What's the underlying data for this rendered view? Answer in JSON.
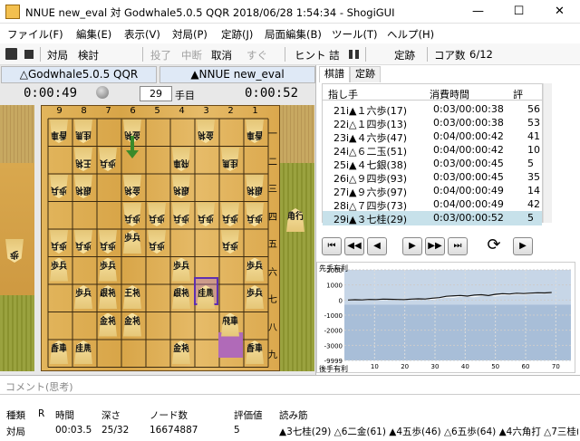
{
  "window": {
    "title": "NNUE new_eval 対 Godwhale5.0.5 QQR 2018/06/28 1:54:34 - ShogiGUI",
    "minimize": "—",
    "maximize": "☐",
    "close": "✕"
  },
  "menu": [
    "ファイル(F)",
    "編集(E)",
    "表示(V)",
    "対局(P)",
    "定跡(J)",
    "局面編集(B)",
    "ツール(T)",
    "ヘルプ(H)"
  ],
  "toolbar": {
    "save_icon": "save-icon",
    "stop_icon": "stop-icon",
    "taikyoku": "対局",
    "kento": "検討",
    "touryo": "投了",
    "chudan": "中断",
    "torikeshi": "取消",
    "sugu": "すぐ",
    "hint": "ヒント",
    "tsume": "詰",
    "jouseki": "定跡",
    "core_label": "コア数",
    "core_value": "6/12"
  },
  "players": {
    "gote": "△Godwhale5.0.5 QQR",
    "sente": "▲NNUE new_eval"
  },
  "clock": {
    "gote": "0:00:49",
    "sente": "0:00:52",
    "move_number": "29",
    "move_suffix": "手目"
  },
  "board": {
    "files": [
      "9",
      "8",
      "7",
      "6",
      "5",
      "4",
      "3",
      "2",
      "1"
    ],
    "ranks": [
      "一",
      "二",
      "三",
      "四",
      "五",
      "六",
      "七",
      "八",
      "九"
    ],
    "pieces": [
      {
        "f": 9,
        "r": 1,
        "p": "香車",
        "side": "gote"
      },
      {
        "f": 8,
        "r": 1,
        "p": "桂馬",
        "side": "gote"
      },
      {
        "f": 6,
        "r": 1,
        "p": "金将",
        "side": "gote"
      },
      {
        "f": 3,
        "r": 1,
        "p": "金将",
        "side": "gote"
      },
      {
        "f": 1,
        "r": 1,
        "p": "香車",
        "side": "gote"
      },
      {
        "f": 8,
        "r": 2,
        "p": "王将",
        "side": "gote"
      },
      {
        "f": 4,
        "r": 2,
        "p": "飛車",
        "side": "gote"
      },
      {
        "f": 2,
        "r": 2,
        "p": "桂馬",
        "side": "gote"
      },
      {
        "f": 8,
        "r": 3,
        "p": "銀将",
        "side": "gote"
      },
      {
        "f": 6,
        "r": 3,
        "p": "金将",
        "side": "gote"
      },
      {
        "f": 4,
        "r": 3,
        "p": "銀将",
        "side": "gote"
      },
      {
        "f": 1,
        "r": 3,
        "p": "銀将",
        "side": "gote"
      },
      {
        "f": 6,
        "r": 4,
        "p": "歩兵",
        "side": "gote"
      },
      {
        "f": 5,
        "r": 4,
        "p": "歩兵",
        "side": "gote"
      },
      {
        "f": 4,
        "r": 4,
        "p": "歩兵",
        "side": "gote"
      },
      {
        "f": 3,
        "r": 4,
        "p": "歩兵",
        "side": "gote"
      },
      {
        "f": 2,
        "r": 4,
        "p": "歩兵",
        "side": "gote"
      },
      {
        "f": 1,
        "r": 4,
        "p": "歩兵",
        "side": "gote"
      },
      {
        "f": 9,
        "r": 5,
        "p": "歩兵",
        "side": "gote"
      },
      {
        "f": 8,
        "r": 5,
        "p": "歩兵",
        "side": "gote"
      },
      {
        "f": 7,
        "r": 5,
        "p": "歩兵",
        "side": "gote"
      },
      {
        "f": 5,
        "r": 5,
        "p": "歩兵",
        "side": "gote"
      },
      {
        "f": 2,
        "r": 5,
        "p": "歩兵",
        "side": "gote"
      },
      {
        "f": 7,
        "r": 2,
        "p": "歩兵",
        "side": "gote"
      },
      {
        "f": 9,
        "r": 3,
        "p": "歩兵",
        "side": "gote"
      },
      {
        "f": 9,
        "r": 6,
        "p": "歩兵",
        "side": "sente"
      },
      {
        "f": 7,
        "r": 6,
        "p": "歩兵",
        "side": "sente"
      },
      {
        "f": 4,
        "r": 6,
        "p": "歩兵",
        "side": "sente"
      },
      {
        "f": 1,
        "r": 6,
        "p": "歩兵",
        "side": "sente"
      },
      {
        "f": 8,
        "r": 7,
        "p": "歩兵",
        "side": "sente"
      },
      {
        "f": 7,
        "r": 7,
        "p": "銀将",
        "side": "sente"
      },
      {
        "f": 6,
        "r": 7,
        "p": "王将",
        "side": "sente"
      },
      {
        "f": 4,
        "r": 7,
        "p": "銀将",
        "side": "sente"
      },
      {
        "f": 3,
        "r": 7,
        "p": "桂馬",
        "side": "sente"
      },
      {
        "f": 1,
        "r": 7,
        "p": "歩兵",
        "side": "sente"
      },
      {
        "f": 7,
        "r": 8,
        "p": "金将",
        "side": "sente"
      },
      {
        "f": 6,
        "r": 8,
        "p": "金将",
        "side": "sente"
      },
      {
        "f": 2,
        "r": 8,
        "p": "飛車",
        "side": "sente"
      },
      {
        "f": 9,
        "r": 9,
        "p": "香車",
        "side": "sente"
      },
      {
        "f": 8,
        "r": 9,
        "p": "桂馬",
        "side": "sente"
      },
      {
        "f": 4,
        "r": 9,
        "p": "金将",
        "side": "sente"
      },
      {
        "f": 1,
        "r": 9,
        "p": "香車",
        "side": "sente"
      },
      {
        "f": 6,
        "r": 5,
        "p": "歩兵",
        "side": "sente"
      }
    ],
    "hand_gote": "歩",
    "hand_sente": "角行"
  },
  "tabs": [
    "棋譜",
    "定跡"
  ],
  "movelist": {
    "headers": [
      "指し手",
      "消費時間",
      "評"
    ],
    "rows": [
      {
        "move": "21i▲１六歩(17)",
        "time": "0:03/00:00:38",
        "ev": "56"
      },
      {
        "move": "22i△１四歩(13)",
        "time": "0:03/00:00:38",
        "ev": "53"
      },
      {
        "move": "23i▲４六歩(47)",
        "time": "0:04/00:00:42",
        "ev": "41"
      },
      {
        "move": "24i△６二玉(51)",
        "time": "0:04/00:00:42",
        "ev": "10"
      },
      {
        "move": "25i▲４七銀(38)",
        "time": "0:03/00:00:45",
        "ev": "5"
      },
      {
        "move": "26i△９四歩(93)",
        "time": "0:03/00:00:45",
        "ev": "35"
      },
      {
        "move": "27i▲９六歩(97)",
        "time": "0:04/00:00:49",
        "ev": "14"
      },
      {
        "move": "28i△７四歩(73)",
        "time": "0:04/00:00:49",
        "ev": "42"
      },
      {
        "move": "29i▲３七桂(29)",
        "time": "0:03/00:00:52",
        "ev": "5"
      }
    ],
    "selected": 8
  },
  "nav": {
    "first": "⏮",
    "prev10": "◀◀",
    "prev": "◀",
    "next": "▶",
    "next10": "▶▶",
    "last": "⏭",
    "rotate": "⟳",
    "play": "▶"
  },
  "graph": {
    "top_label": "先手有利",
    "bottom_label": "後手有利",
    "yticks": [
      "2000",
      "1000",
      "0",
      "-1000",
      "-2000",
      "-3000",
      "-9999"
    ],
    "xticks": [
      "10",
      "20",
      "30",
      "40",
      "50",
      "60",
      "70"
    ],
    "series_black": [
      0,
      20,
      10,
      40,
      30,
      60,
      50,
      40,
      30,
      60,
      80,
      70,
      120,
      160,
      250,
      280,
      300,
      260,
      330,
      350,
      300,
      380,
      420,
      400,
      450,
      430,
      460,
      480,
      470,
      500
    ],
    "series_white": [
      0,
      -10,
      20,
      10,
      40,
      30,
      50,
      40,
      60,
      40,
      50,
      80,
      60,
      120,
      200,
      180,
      260,
      240,
      220,
      300,
      320,
      280,
      360,
      350,
      400,
      380,
      420,
      460,
      440,
      480
    ]
  },
  "comment": {
    "label": "コメント(思考)"
  },
  "engine": {
    "headers": [
      "種類",
      "R",
      "時間",
      "深さ",
      "ノード数",
      "評価値",
      "読み筋"
    ],
    "values": [
      "対局",
      "",
      "00:03.5",
      "25/32",
      "16674887",
      "5",
      "▲3七桂(29) △6二金(61) ▲4五歩(46) △6五歩(64) ▲4六角打 △7三桂(81)"
    ]
  }
}
